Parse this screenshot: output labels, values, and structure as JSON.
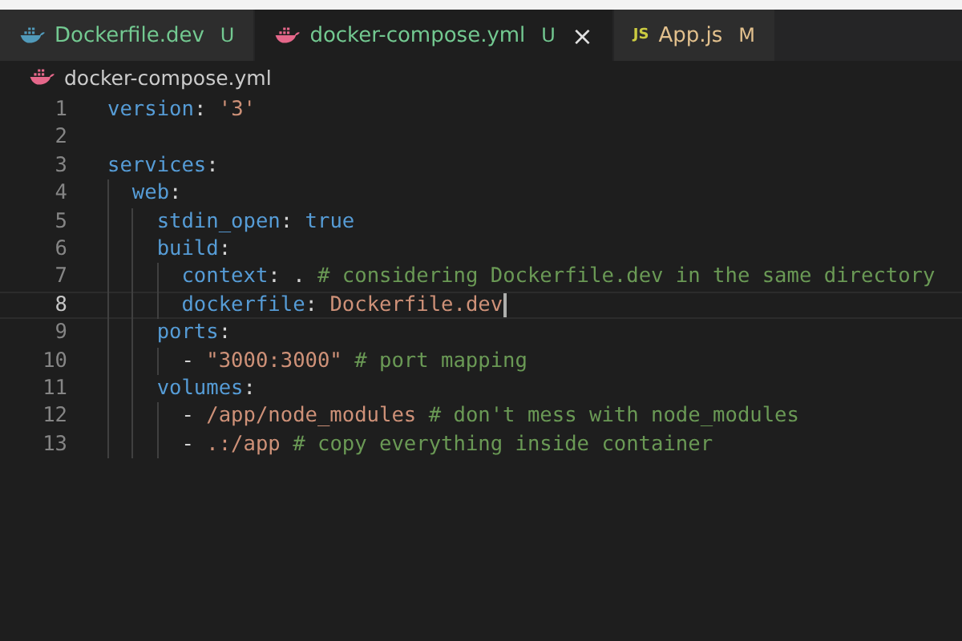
{
  "tabs": [
    {
      "label": "Dockerfile.dev",
      "status": "U",
      "kind": "docker",
      "color": "#73c991",
      "selected": false
    },
    {
      "label": "docker-compose.yml",
      "status": "U",
      "kind": "docker",
      "color": "#73c991",
      "selected": true,
      "close": "×"
    },
    {
      "label": "App.js",
      "status": "M",
      "kind": "js",
      "icon_text": "JS",
      "color": "#e2c08d",
      "selected": false
    }
  ],
  "breadcrumb": {
    "label": "docker-compose.yml",
    "kind": "docker"
  },
  "editor": {
    "lines": [
      {
        "number": "1",
        "current": false,
        "tokens": [
          {
            "kind": "key",
            "text": "version"
          },
          {
            "kind": "punct",
            "text": ": "
          },
          {
            "kind": "string",
            "text": "'3'"
          }
        ]
      },
      {
        "number": "2",
        "current": false
      },
      {
        "number": "3",
        "current": false,
        "tokens": [
          {
            "kind": "key",
            "text": "services"
          },
          {
            "kind": "punct",
            "text": ":"
          }
        ]
      },
      {
        "number": "4",
        "current": false,
        "tokens": [
          {
            "kind": "key",
            "text": "  web"
          },
          {
            "kind": "punct",
            "text": ":"
          }
        ]
      },
      {
        "number": "5",
        "current": false,
        "tokens": [
          {
            "kind": "key",
            "text": "    stdin_open"
          },
          {
            "kind": "punct",
            "text": ": "
          },
          {
            "kind": "keyword",
            "text": "true"
          }
        ]
      },
      {
        "number": "6",
        "current": false,
        "tokens": [
          {
            "kind": "key",
            "text": "    build"
          },
          {
            "kind": "punct",
            "text": ":"
          }
        ]
      },
      {
        "number": "7",
        "current": false,
        "tokens": [
          {
            "kind": "key",
            "text": "      context"
          },
          {
            "kind": "punct",
            "text": ": . "
          },
          {
            "kind": "comment",
            "text": "# considering Dockerfile.dev in the same directory"
          }
        ]
      },
      {
        "number": "8",
        "current": true,
        "tokens": [
          {
            "kind": "key",
            "text": "      dockerfile"
          },
          {
            "kind": "punct",
            "text": ": "
          },
          {
            "kind": "string",
            "text": "Dockerfile.dev"
          }
        ]
      },
      {
        "number": "9",
        "current": false,
        "tokens": [
          {
            "kind": "key",
            "text": "    ports"
          },
          {
            "kind": "punct",
            "text": ":"
          }
        ]
      },
      {
        "number": "10",
        "current": false,
        "tokens": [
          {
            "kind": "punct",
            "text": "      - "
          },
          {
            "kind": "string",
            "text": "\"3000:3000\""
          },
          {
            "kind": "comment",
            "text": " # port mapping"
          }
        ]
      },
      {
        "number": "11",
        "current": false,
        "tokens": [
          {
            "kind": "key",
            "text": "    volumes"
          },
          {
            "kind": "punct",
            "text": ":"
          }
        ]
      },
      {
        "number": "12",
        "current": false,
        "tokens": [
          {
            "kind": "punct",
            "text": "      - "
          },
          {
            "kind": "string",
            "text": "/app/node_modules"
          },
          {
            "kind": "comment",
            "text": " # don't mess with node_modules"
          }
        ]
      },
      {
        "number": "13",
        "current": false,
        "tokens": [
          {
            "kind": "punct",
            "text": "      - "
          },
          {
            "kind": "string",
            "text": ".:/app"
          },
          {
            "kind": "comment",
            "text": " # copy everything inside container"
          }
        ]
      }
    ]
  }
}
